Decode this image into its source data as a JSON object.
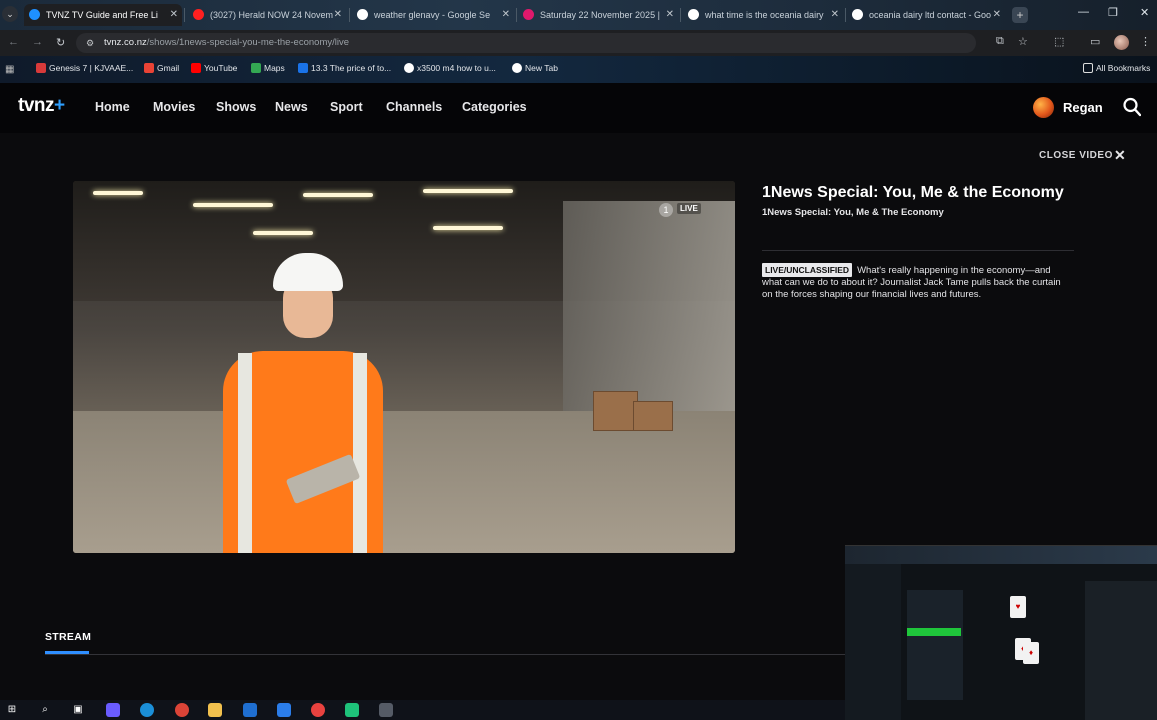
{
  "browser": {
    "tabs": [
      {
        "title": "TVNZ TV Guide and Free Li",
        "active": true,
        "favicon_color": "#1e90ff"
      },
      {
        "title": "(3027) Herald NOW 24 Novem",
        "active": false,
        "favicon_color": "#ff2020"
      },
      {
        "title": "weather glenavy - Google Se",
        "active": false,
        "favicon_color": "#ffffff"
      },
      {
        "title": "Saturday 22 November 2025 |",
        "active": false,
        "favicon_color": "#e0196c"
      },
      {
        "title": "what time is the oceania dairy",
        "active": false,
        "favicon_color": "#ffffff"
      },
      {
        "title": "oceania dairy ltd contact - Goo",
        "active": false,
        "favicon_color": "#ffffff"
      }
    ],
    "url_host": "tvnz.co.nz",
    "url_path": "/shows/1news-special-you-me-the-economy/live",
    "bookmarks": [
      {
        "label": "Genesis 7 | KJVAAE...",
        "icon_color": "#d83a3a"
      },
      {
        "label": "Gmail",
        "icon_color": "#ea4335"
      },
      {
        "label": "YouTube",
        "icon_color": "#ff0000"
      },
      {
        "label": "Maps",
        "icon_color": "#34a853"
      },
      {
        "label": "13.3 The price of to...",
        "icon_color": "#1a73e8"
      },
      {
        "label": "x3500 m4 how to u...",
        "icon_color": "#ffffff"
      },
      {
        "label": "New Tab",
        "icon_color": "#ffffff"
      }
    ],
    "all_bookmarks": "All Bookmarks"
  },
  "site": {
    "logo": "tvnz",
    "logo_plus": "+",
    "nav": [
      "Home",
      "Movies",
      "Shows",
      "News",
      "Sport",
      "Channels",
      "Categories"
    ],
    "user_name": "Regan",
    "accent": "#2f8fff"
  },
  "main": {
    "close_video": "CLOSE VIDEO",
    "player": {
      "channel": "1",
      "live_label": "LIVE"
    },
    "show_title": "1News Special: You, Me & the Economy",
    "episode_title": "1News Special: You, Me & The Economy",
    "badge": "LIVE/UNCLASSIFIED",
    "description": "What's really happening in the economy—and what can we do to about it? Journalist Jack Tame pulls back the curtain on the forces shaping our financial lives and futures.",
    "stream_tab": "STREAM"
  }
}
